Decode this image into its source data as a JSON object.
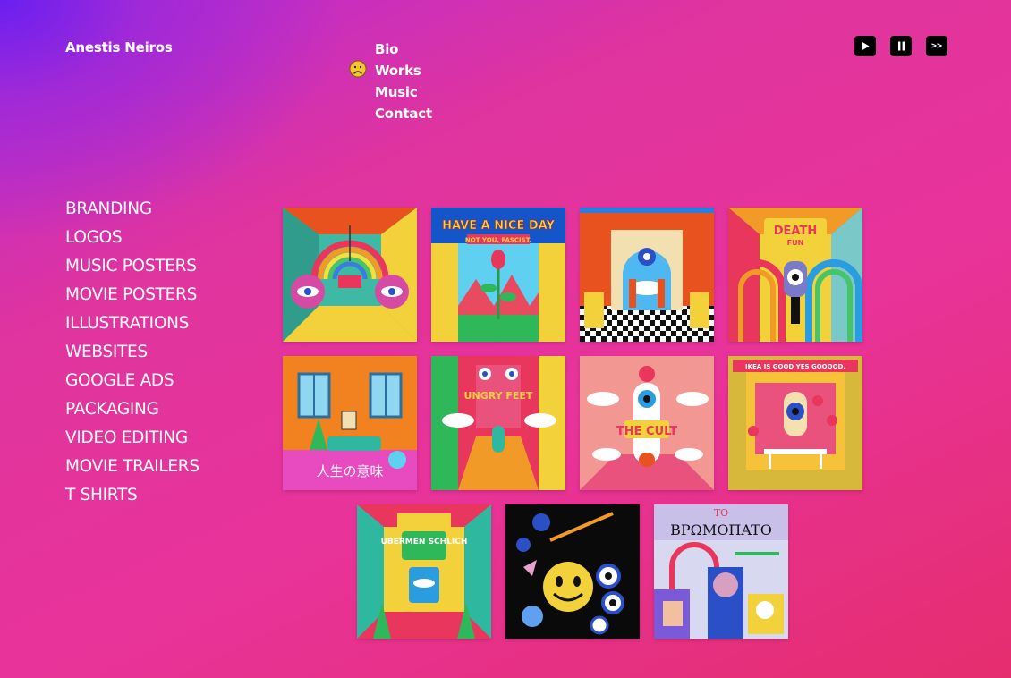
{
  "header": {
    "artist_name": "Anestis Neiros",
    "nav": [
      {
        "label": "Bio"
      },
      {
        "label": "Works"
      },
      {
        "label": "Music"
      },
      {
        "label": "Contact"
      }
    ],
    "active_nav_icon": "frown-face-icon",
    "player": {
      "play_icon": "play-icon",
      "pause_icon": "pause-icon",
      "next_label": ">>"
    }
  },
  "categories": [
    "BRANDING",
    "LOGOS",
    "MUSIC POSTERS",
    "MOVIE POSTERS",
    "ILLUSTRATIONS",
    "WEBSITES",
    "GOOGLE ADS",
    "PACKAGING",
    "VIDEO EDITING",
    "MOVIE TRAILERS",
    "T SHIRTS"
  ],
  "gallery": [
    {
      "name": "rainbow-eyes-artwork",
      "text": ""
    },
    {
      "name": "have-a-nice-day-artwork",
      "text": "HAVE A NICE DAY",
      "subtext": "NOT YOU, FASCIST."
    },
    {
      "name": "checkered-temple-artwork",
      "text": ""
    },
    {
      "name": "death-fun-artwork",
      "text": "DEATH",
      "subtext": "FUN"
    },
    {
      "name": "jinsei-no-imi-artwork",
      "text": "人生の意味"
    },
    {
      "name": "ungry-feet-artwork",
      "text": "UNGRY FEET"
    },
    {
      "name": "the-cult-artwork",
      "text": "THE CULT"
    },
    {
      "name": "ikea-is-good-artwork",
      "text": "IKEA IS GOOD YES GOOOOD."
    },
    {
      "name": "ubermenschlich-artwork",
      "text": "UBERMEN SCHLICH"
    },
    {
      "name": "smiley-eyes-artwork",
      "text": ""
    },
    {
      "name": "to-vromopato-artwork",
      "text": "TO",
      "subtext": "BPΩMOΠATO"
    }
  ],
  "colors": {
    "background_top_left": "#6a1ff0",
    "background_main": "#e8339a",
    "background_bottom_right": "#e52d6e",
    "text": "#ffffff",
    "player_button": "#000000"
  }
}
